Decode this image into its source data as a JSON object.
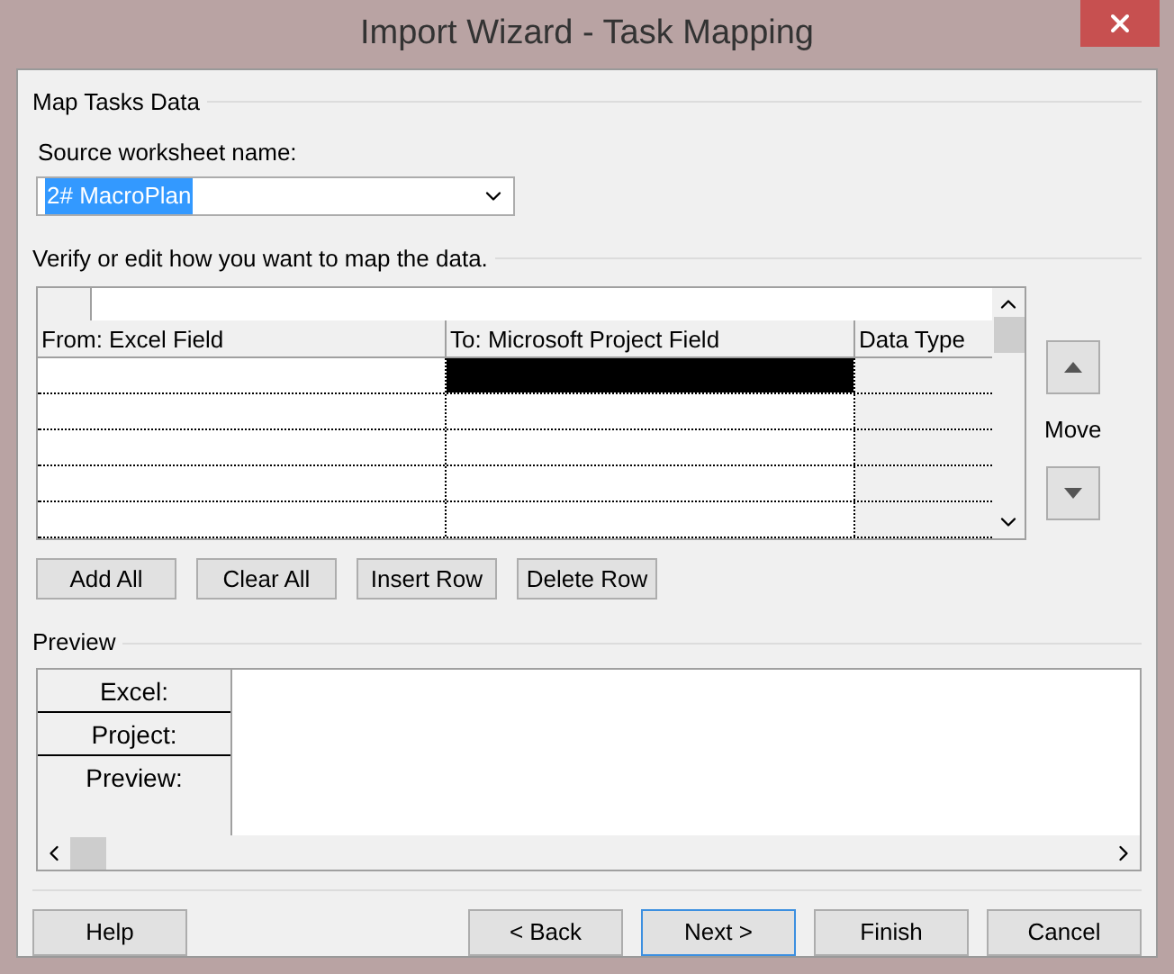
{
  "window": {
    "title": "Import Wizard - Task Mapping"
  },
  "section_title": "Map Tasks Data",
  "source": {
    "label": "Source worksheet name:",
    "value": "2# MacroPlan"
  },
  "mapping_title": "Verify or edit how you want to map the data.",
  "grid": {
    "columns": [
      "From: Excel Field",
      "To:  Microsoft Project Field",
      "Data Type"
    ],
    "rows": [
      {
        "selected": true
      },
      {
        "selected": false
      },
      {
        "selected": false
      },
      {
        "selected": false
      },
      {
        "selected": false
      }
    ]
  },
  "grid_buttons": [
    "Add All",
    "Clear All",
    "Insert Row",
    "Delete Row"
  ],
  "move_label": "Move",
  "preview": {
    "title": "Preview",
    "row_labels": [
      "Excel:",
      "Project:",
      "Preview:"
    ]
  },
  "footer_buttons": [
    {
      "label": "Help",
      "default": false
    },
    {
      "label": "< Back",
      "default": false
    },
    {
      "label": "Next >",
      "default": true
    },
    {
      "label": "Finish",
      "default": false
    },
    {
      "label": "Cancel",
      "default": false
    }
  ]
}
